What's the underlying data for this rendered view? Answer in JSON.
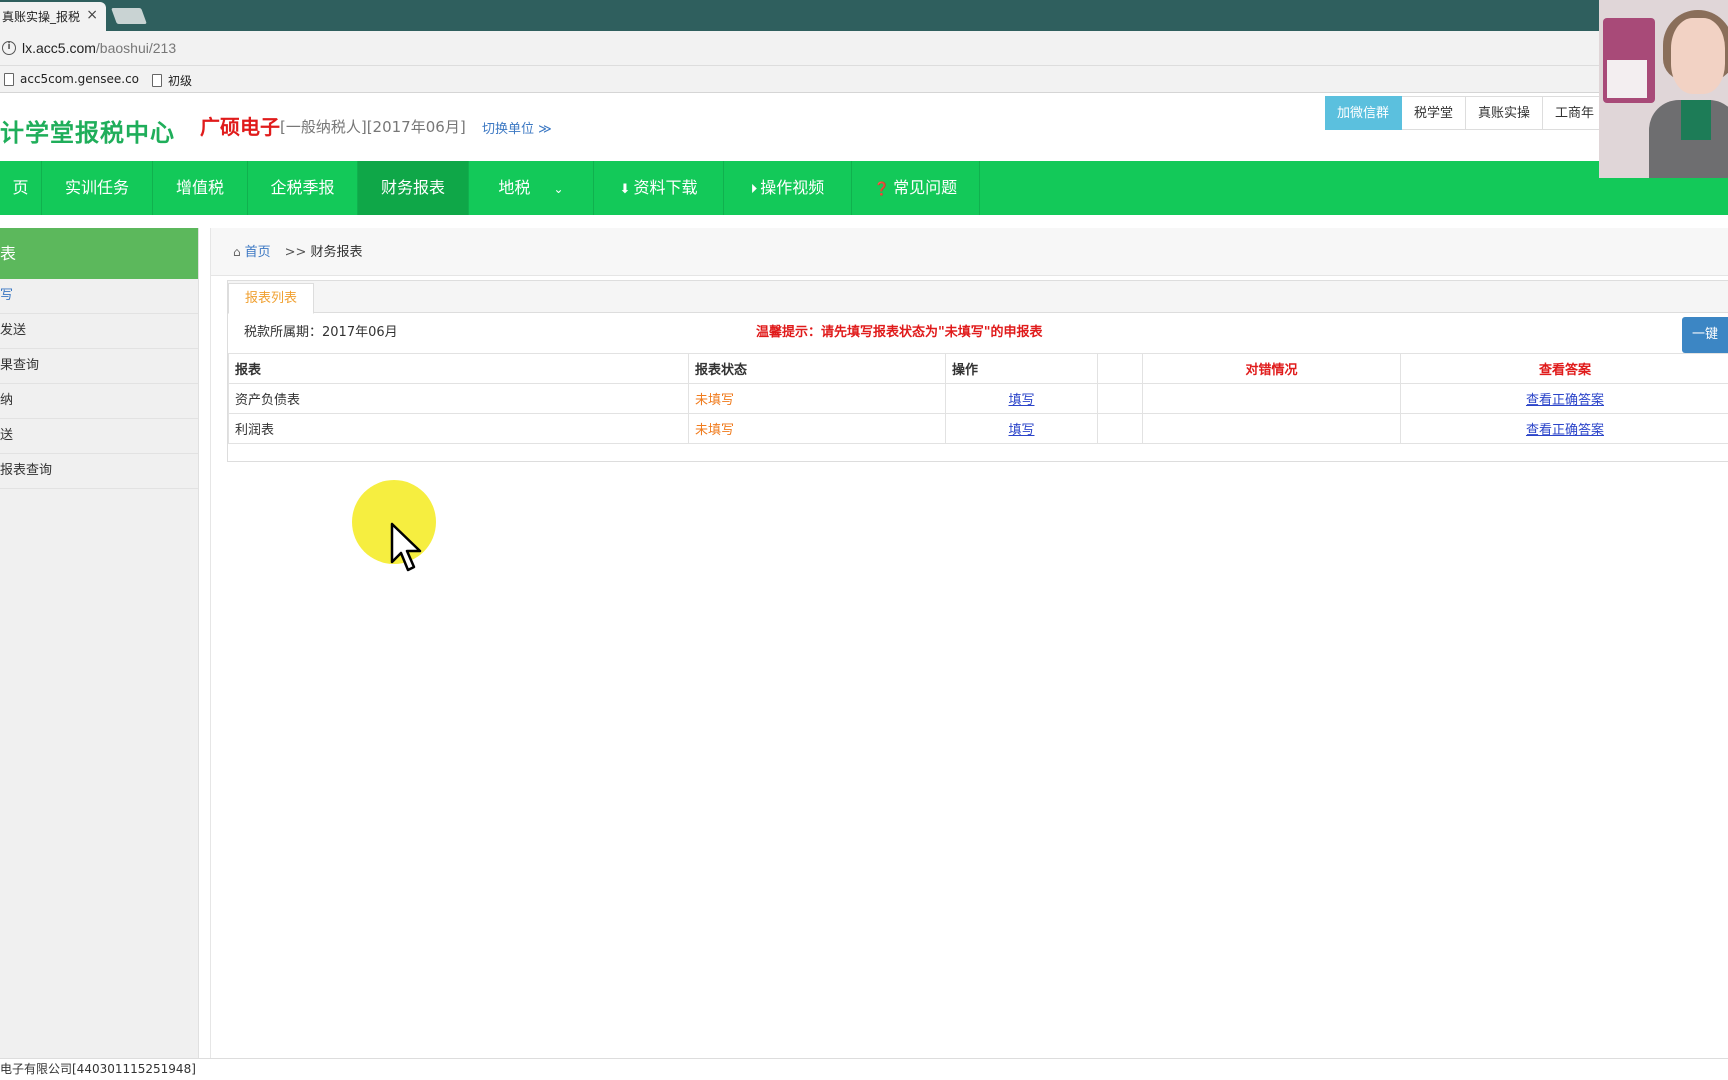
{
  "browser": {
    "tab_title": "真账实操_报税",
    "tab_close": "×",
    "url_host": "lx.acc5.com",
    "url_path": "/baoshui/213",
    "bookmarks": [
      {
        "label": "acc5com.gensee.co"
      },
      {
        "label": "初级"
      }
    ]
  },
  "header": {
    "logo": "计学堂报税中心",
    "company": "广硕电子",
    "company_meta": "[一般纳税人][2017年06月]",
    "switch_unit": "切换单位 ≫",
    "top_links": [
      "加微信群",
      "税学堂",
      "真账实操",
      "工商年"
    ]
  },
  "nav": {
    "items": [
      {
        "label": "页"
      },
      {
        "label": "实训任务"
      },
      {
        "label": "增值税"
      },
      {
        "label": "企税季报"
      },
      {
        "label": "财务报表"
      },
      {
        "label": "地税"
      },
      {
        "label": "资料下载"
      },
      {
        "label": "操作视频"
      },
      {
        "label": "常见问题"
      }
    ]
  },
  "sidebar": {
    "title": "表",
    "items": [
      "写",
      "发送",
      "果查询",
      "纳",
      "送",
      "报表查询"
    ]
  },
  "breadcrumb": {
    "home": "首页",
    "separator": ">>",
    "current": "财务报表"
  },
  "panel": {
    "tab": "报表列表",
    "period": "税款所属期：2017年06月",
    "hint": "温馨提示：请先填写报表状态为\"未填写\"的申报表",
    "oneclick": "一键"
  },
  "table": {
    "headers": [
      "报表",
      "报表状态",
      "操作",
      "",
      "对错情况",
      "查看答案"
    ],
    "rows": [
      {
        "name": "资产负债表",
        "status": "未填写",
        "action": "填写",
        "extra": "",
        "result": "",
        "answer": "查看正确答案"
      },
      {
        "name": "利润表",
        "status": "未填写",
        "action": "填写",
        "extra": "",
        "result": "",
        "answer": "查看正确答案"
      }
    ]
  },
  "footer": {
    "text": "电子有限公司[440301115251948]"
  },
  "colors": {
    "nav_green": "#13c959",
    "nav_active": "#0fa748",
    "sidebar_head": "#5cb85c",
    "alert_red": "#e01b1b",
    "status_orange": "#f07b1d",
    "link_blue": "#2b44c9"
  }
}
